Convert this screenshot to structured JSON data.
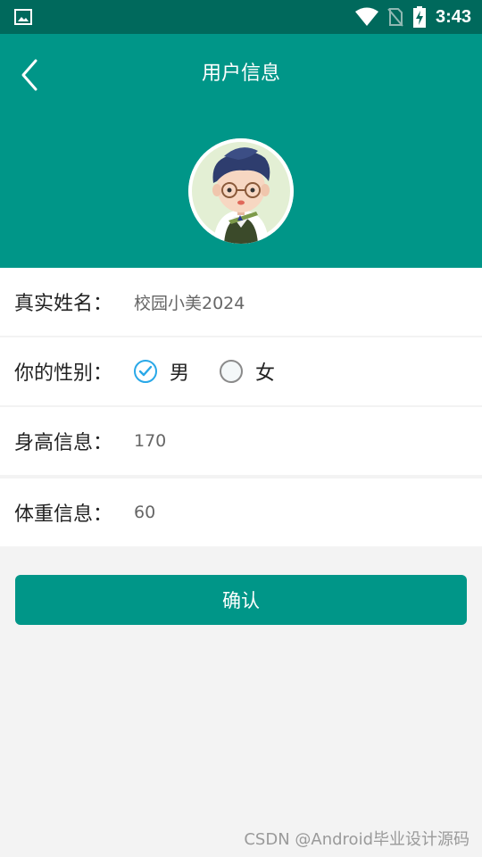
{
  "status_bar": {
    "time": "3:43",
    "icons": [
      "image-icon",
      "wifi-icon",
      "no-sim-icon",
      "battery-charging-icon"
    ]
  },
  "header": {
    "title": "用户信息",
    "back_icon": "chevron-left-icon",
    "avatar_icon": "cartoon-boy-avatar"
  },
  "form": {
    "real_name": {
      "label": "真实姓名：",
      "value": "校园小美2024"
    },
    "gender": {
      "label": "你的性别：",
      "options": [
        {
          "label": "男",
          "checked": true
        },
        {
          "label": "女",
          "checked": false
        }
      ]
    },
    "height": {
      "label": "身高信息：",
      "value": "170"
    },
    "weight": {
      "label": "体重信息：",
      "value": "60"
    }
  },
  "confirm_button": {
    "label": "确认"
  },
  "watermark": "CSDN @Android毕业设计源码",
  "colors": {
    "status_bar": "#00695c",
    "primary": "#009688",
    "radio_checked": "#29a8e8",
    "background": "#f3f3f3"
  }
}
